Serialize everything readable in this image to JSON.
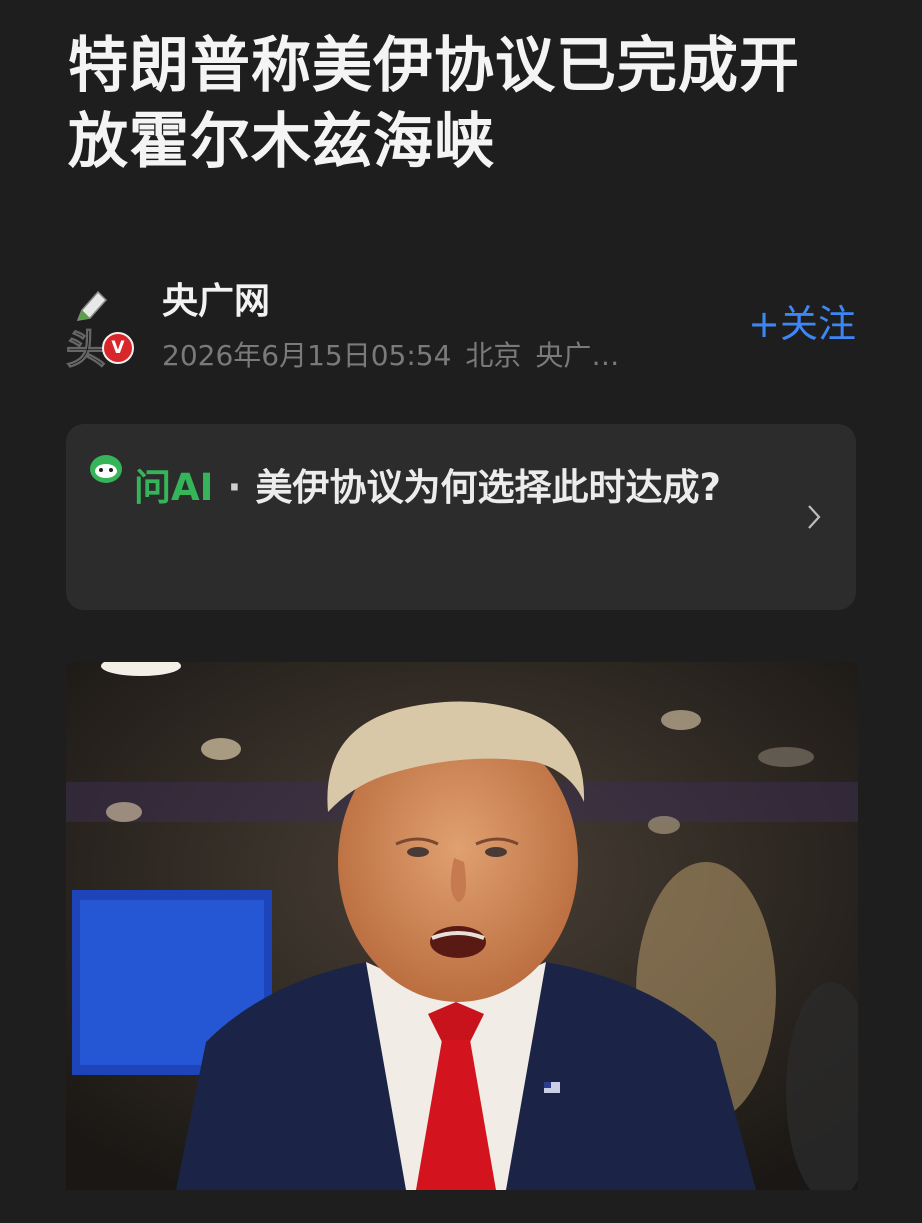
{
  "article": {
    "title": "特朗普称美伊协议已完成开放霍尔木兹海峡"
  },
  "author": {
    "avatar_char": "头",
    "verified_badge": "V",
    "name": "央广网",
    "datetime": "2026年6月15日05:54",
    "location": "北京",
    "source_truncated": "央广…",
    "follow_label": "+关注"
  },
  "ai_card": {
    "label": "问AI",
    "separator": "·",
    "question": "美伊协议为何选择此时达成?",
    "icon": "ai-mascot-icon",
    "accent": "#35b45a"
  },
  "photo": {
    "icon": "news-photo"
  },
  "colors": {
    "background": "#1e1e1e",
    "card": "#2c2c2c",
    "follow": "#3d86f6",
    "meta": "#7a7a7a"
  }
}
